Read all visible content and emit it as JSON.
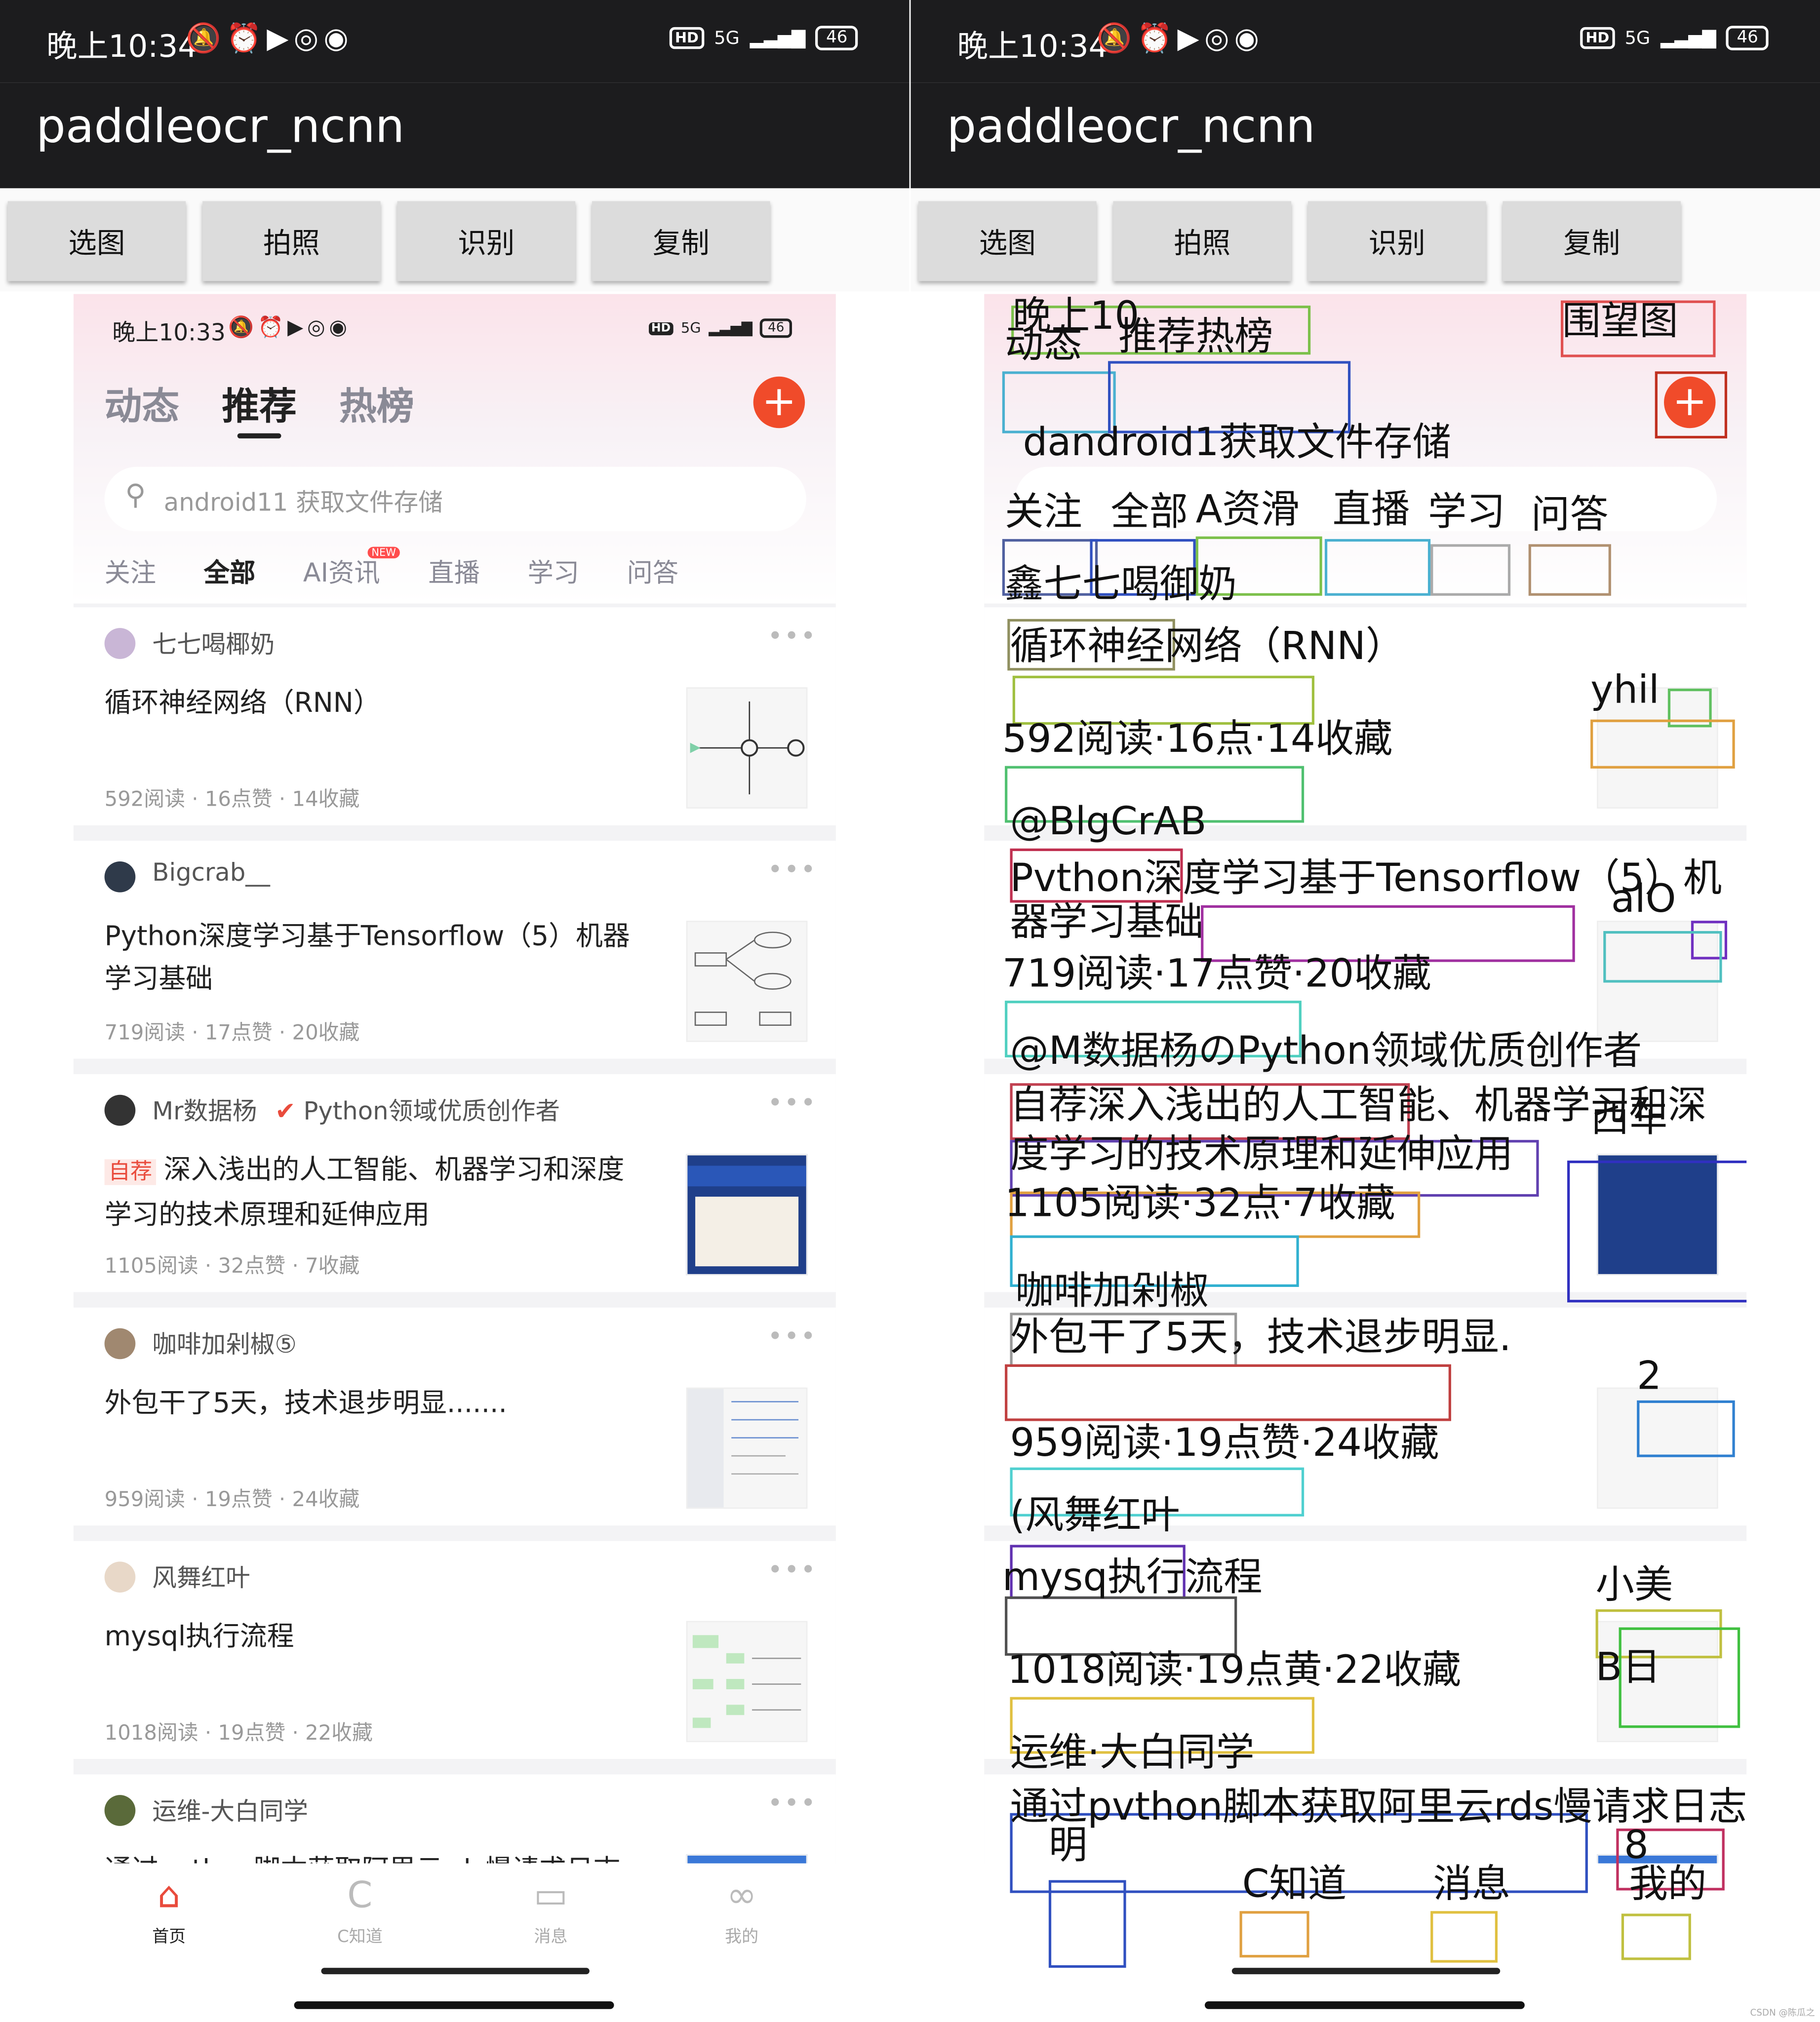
{
  "left": {
    "status": {
      "time": "晚上10:34",
      "icons": "🔕⏰▶◎◉",
      "hd": "HD",
      "net": "5G",
      "battery": "46"
    },
    "app_title": "paddleocr_ncnn",
    "buttons": [
      "选图",
      "拍照",
      "识别",
      "复制"
    ],
    "screen": {
      "status": {
        "time": "晚上10:33",
        "icons": "🔕⏰▶◎◉",
        "hd": "HD",
        "net": "5G",
        "battery": "46"
      },
      "tabs": [
        "动态",
        "推荐",
        "热榜"
      ],
      "plus": "+",
      "search_placeholder": "android11 获取文件存储",
      "categories": [
        "关注",
        "全部",
        "AI资讯",
        "直播",
        "学习",
        "问答"
      ],
      "new_badge": "NEW",
      "cards": [
        {
          "author": "七七喝椰奶",
          "title": "循环神经网络（RNN）",
          "meta": "592阅读 · 16点赞 · 14收藏",
          "avatar": "#c9b6d6"
        },
        {
          "author": "Bigcrab__",
          "title": "Python深度学习基于Tensorflow（5）机器学习基础",
          "meta": "719阅读 · 17点赞 · 20收藏",
          "avatar": "#2f3a4a"
        },
        {
          "author": "Mr数据杨",
          "badge": "Python领域优质创作者",
          "tag": "自荐",
          "title": "深入浅出的人工智能、机器学习和深度学习的技术原理和延伸应用",
          "meta": "1105阅读 · 32点赞 · 7收藏",
          "avatar": "#333333"
        },
        {
          "author": "咖啡加剁椒⑤",
          "title": "外包干了5天，技术退步明显.......",
          "meta": "959阅读 · 19点赞 · 24收藏",
          "avatar": "#a08870"
        },
        {
          "author": "风舞红叶",
          "title": "mysql执行流程",
          "meta": "1018阅读 · 19点赞 · 22收藏",
          "avatar": "#e8d8c8"
        },
        {
          "author": "运维-大白同学",
          "title": "通过python脚本获取阿里云rds慢请求日志",
          "meta": "",
          "avatar": "#5a6a3a"
        }
      ],
      "nav": [
        {
          "label": "首页",
          "icon": "⌂"
        },
        {
          "label": "C知道",
          "icon": "C"
        },
        {
          "label": "消息",
          "icon": "▭"
        },
        {
          "label": "我的",
          "icon": "∞"
        }
      ]
    }
  },
  "right": {
    "status": {
      "time": "晚上10:34",
      "icons": "🔕⏰▶◎◉",
      "hd": "HD",
      "net": "5G",
      "battery": "46"
    },
    "app_title": "paddleocr_ncnn",
    "buttons": [
      "选图",
      "拍照",
      "识别",
      "复制"
    ],
    "ocr_texts": [
      "晚上10",
      "动态",
      "推荐热榜",
      "围望图",
      "dandroid1获取文件存储",
      "关注",
      "全部",
      "A资滑",
      "直播",
      "学习",
      "问答",
      "鑫七七喝御奶",
      "循环神经网络（RNN）",
      "yhil",
      "592阅读·16点·14收藏",
      "@BlgCrAB",
      "Pvthon深度学习基于Tensorflow（5）机",
      "器学习基础",
      "alO",
      "719阅读·17点赞·20收藏",
      "@M数据杨のPython领域优质创作者",
      "自荐深入浅出的人工智能、机器学习和深",
      "度学习的技术原理和延伸应用",
      "西车",
      "1105阅读·32点·7收藏",
      "咖啡加剁椒",
      "外包干了5天，技术退步明显.",
      "2",
      "959阅读·19点赞·24收藏",
      "(风舞红叶",
      "mysq执行流程",
      "小美",
      "B日",
      "1018阅读·19点黄·22收藏",
      "运维·大白同学",
      "通过pvthon脚本获取阿里云rds慢请求日志",
      "明",
      "C知道",
      "消息",
      "8",
      "我的"
    ]
  },
  "watermark": "CSDN @陈瓜之"
}
